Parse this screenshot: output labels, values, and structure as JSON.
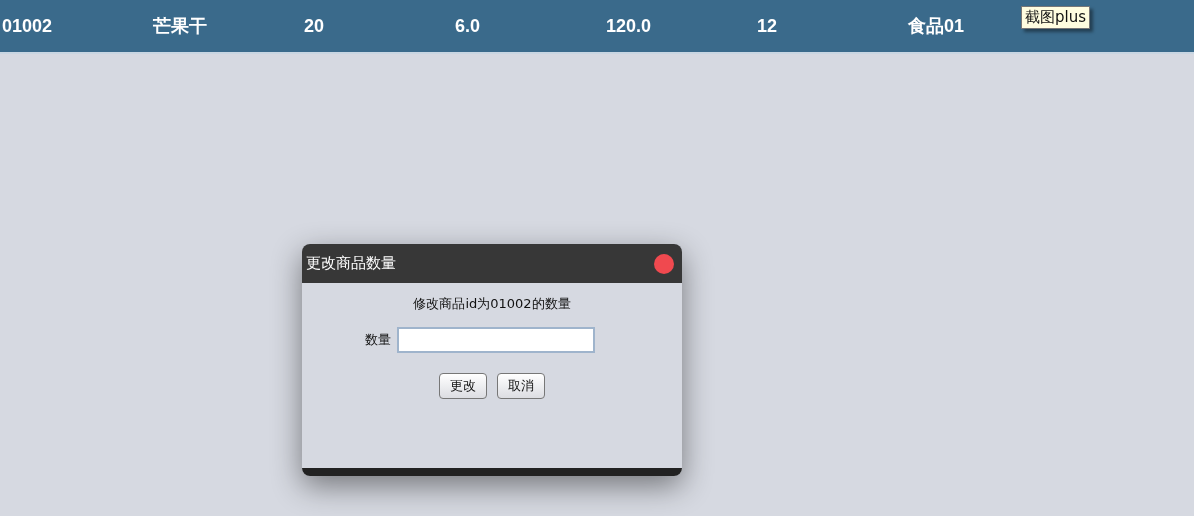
{
  "table": {
    "rows": [
      {
        "cells": [
          "01002",
          "芒果干",
          "20",
          "6.0",
          "120.0",
          "12",
          "食品01"
        ]
      }
    ]
  },
  "tooltip": {
    "text": "截图plus"
  },
  "dialog": {
    "title": "更改商品数量",
    "message": "修改商品id为01002的数量",
    "field": {
      "label": "数量"
    },
    "buttons": [
      "更改",
      "取消"
    ]
  }
}
